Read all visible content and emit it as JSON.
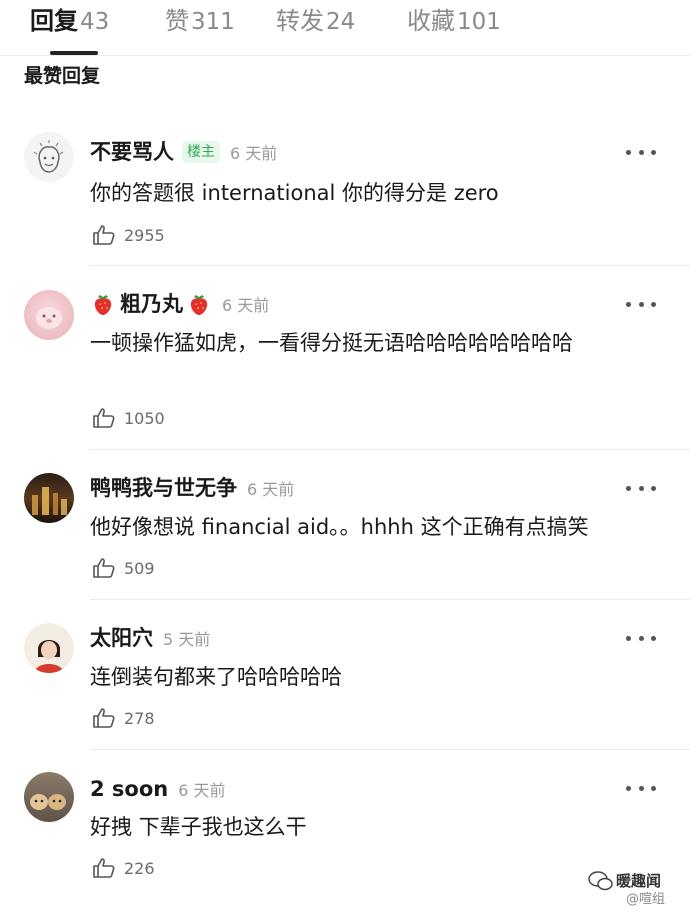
{
  "tabs": [
    {
      "label": "回复",
      "count": "43",
      "active": true
    },
    {
      "label": "赞",
      "count": "311",
      "active": false
    },
    {
      "label": "转发",
      "count": "24",
      "active": false
    },
    {
      "label": "收藏",
      "count": "101",
      "active": false
    }
  ],
  "section_title": "最赞回复",
  "comments": [
    {
      "username": "不要骂人",
      "badge": "楼主",
      "time": "6 天前",
      "text": "你的答题很 international  你的得分是 zero",
      "likes": "2955",
      "avatar": "sketch-face-avatar"
    },
    {
      "username": "粗乃丸",
      "time": "6 天前",
      "text": "一顿操作猛如虎，一看得分挺无语哈哈哈哈哈哈哈哈",
      "likes": "1050",
      "avatar": "pink-avatar",
      "decorations": [
        "strawberry-icon",
        "strawberry-icon"
      ]
    },
    {
      "username": "鸭鸭我与世无争",
      "time": "6 天前",
      "text": "他好像想说 financial aid。。hhhh 这个正确有点搞笑",
      "likes": "509",
      "avatar": "city-night-avatar"
    },
    {
      "username": "太阳穴",
      "time": "5 天前",
      "text": "连倒装句都来了哈哈哈哈哈",
      "likes": "278",
      "avatar": "girl-avatar"
    },
    {
      "username": "2 soon",
      "time": "6 天前",
      "text": "好拽 下辈子我也这么干",
      "likes": "226",
      "avatar": "dogs-avatar"
    }
  ],
  "watermark": {
    "label": "暖趣闻",
    "handle": "@喧组"
  },
  "colors": {
    "badge_text": "#2eaa4f",
    "badge_bg": "#e8f7ec",
    "muted": "#9a9a9a",
    "divider": "#ebebeb"
  }
}
